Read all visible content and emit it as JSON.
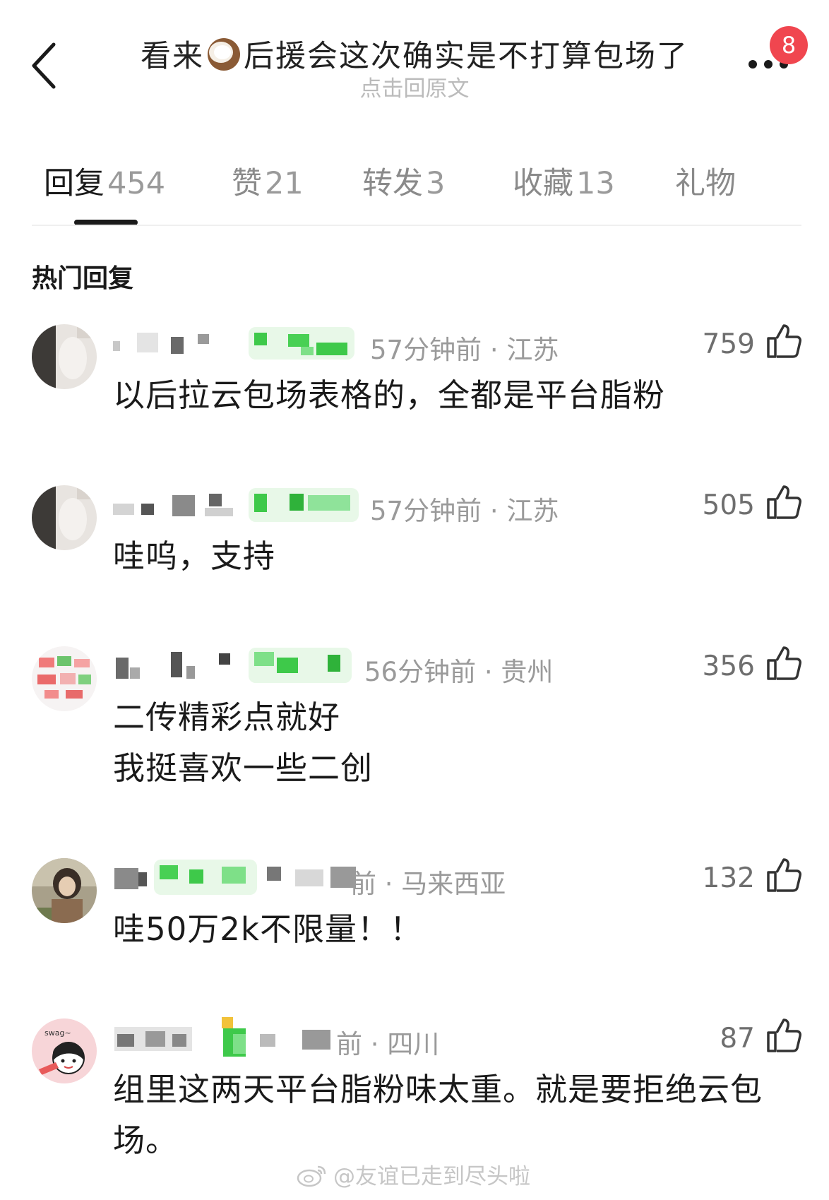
{
  "header": {
    "title_before": "看来",
    "title_emoji": "coconut-emoji",
    "title_after": "后援会这次确实是不打算包场了",
    "subtitle": "点击回原文",
    "more_badge": "8"
  },
  "tabs": [
    {
      "label": "回复",
      "count": "454",
      "active": true
    },
    {
      "label": "赞",
      "count": "21"
    },
    {
      "label": "转发",
      "count": "3"
    },
    {
      "label": "收藏",
      "count": "13"
    },
    {
      "label": "礼物",
      "count": ""
    }
  ],
  "section_title": "热门回复",
  "comments": [
    {
      "meta": "57分钟前 · 江苏",
      "likes": "759",
      "lines": [
        "以后拉云包场表格的，全都是平台脂粉"
      ]
    },
    {
      "meta": "57分钟前 · 江苏",
      "likes": "505",
      "lines": [
        "哇呜，支持"
      ]
    },
    {
      "meta": "56分钟前 · 贵州",
      "likes": "356",
      "lines": [
        "二传精彩点就好",
        "我挺喜欢一些二创"
      ]
    },
    {
      "meta": "前 · 马来西亚",
      "likes": "132",
      "lines": [
        "哇50万2k不限量！！"
      ]
    },
    {
      "meta": "前 · 四川",
      "likes": "87",
      "lines": [
        "组里这两天平台脂粉味太重。就是要拒绝云包",
        "场。"
      ]
    }
  ],
  "avatar_text": "swag~",
  "watermark": "@友谊已走到尽头啦",
  "colors": {
    "badge": "#f0464f",
    "redact_green": "#3ec94a",
    "meta_gray": "#9a9a9a"
  }
}
